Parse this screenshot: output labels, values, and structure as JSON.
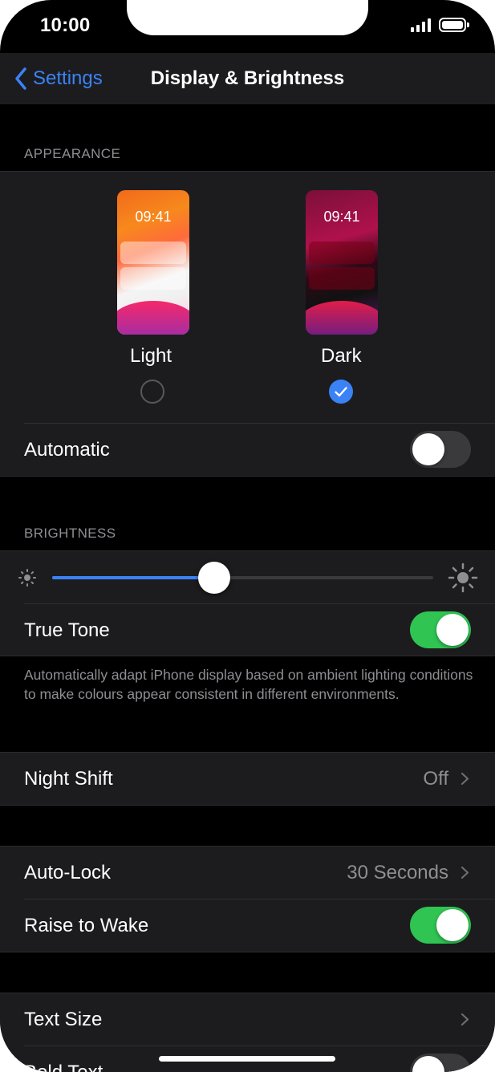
{
  "status_bar": {
    "time": "10:00"
  },
  "nav": {
    "back_label": "Settings",
    "title": "Display & Brightness"
  },
  "appearance": {
    "section_title": "APPEARANCE",
    "light": {
      "preview_time": "09:41",
      "label": "Light",
      "selected": false
    },
    "dark": {
      "preview_time": "09:41",
      "label": "Dark",
      "selected": true
    },
    "automatic_label": "Automatic",
    "automatic_on": false
  },
  "brightness": {
    "section_title": "BRIGHTNESS",
    "level": 0.425,
    "true_tone_label": "True Tone",
    "true_tone_on": true,
    "footer": "Automatically adapt iPhone display based on ambient lighting conditions to make colours appear consistent in different environments."
  },
  "night_shift": {
    "label": "Night Shift",
    "value": "Off"
  },
  "auto_lock": {
    "label": "Auto-Lock",
    "value": "30 Seconds"
  },
  "raise_to_wake": {
    "label": "Raise to Wake",
    "on": true
  },
  "text_size": {
    "label": "Text Size"
  },
  "bold_text": {
    "label": "Bold Text",
    "on": false
  },
  "colors": {
    "accent": "#3b82f6",
    "toggle_on": "#30c452",
    "toggle_off": "#3a3a3c",
    "cell_background": "#1c1c1e",
    "secondary_text": "#8e8e93"
  }
}
